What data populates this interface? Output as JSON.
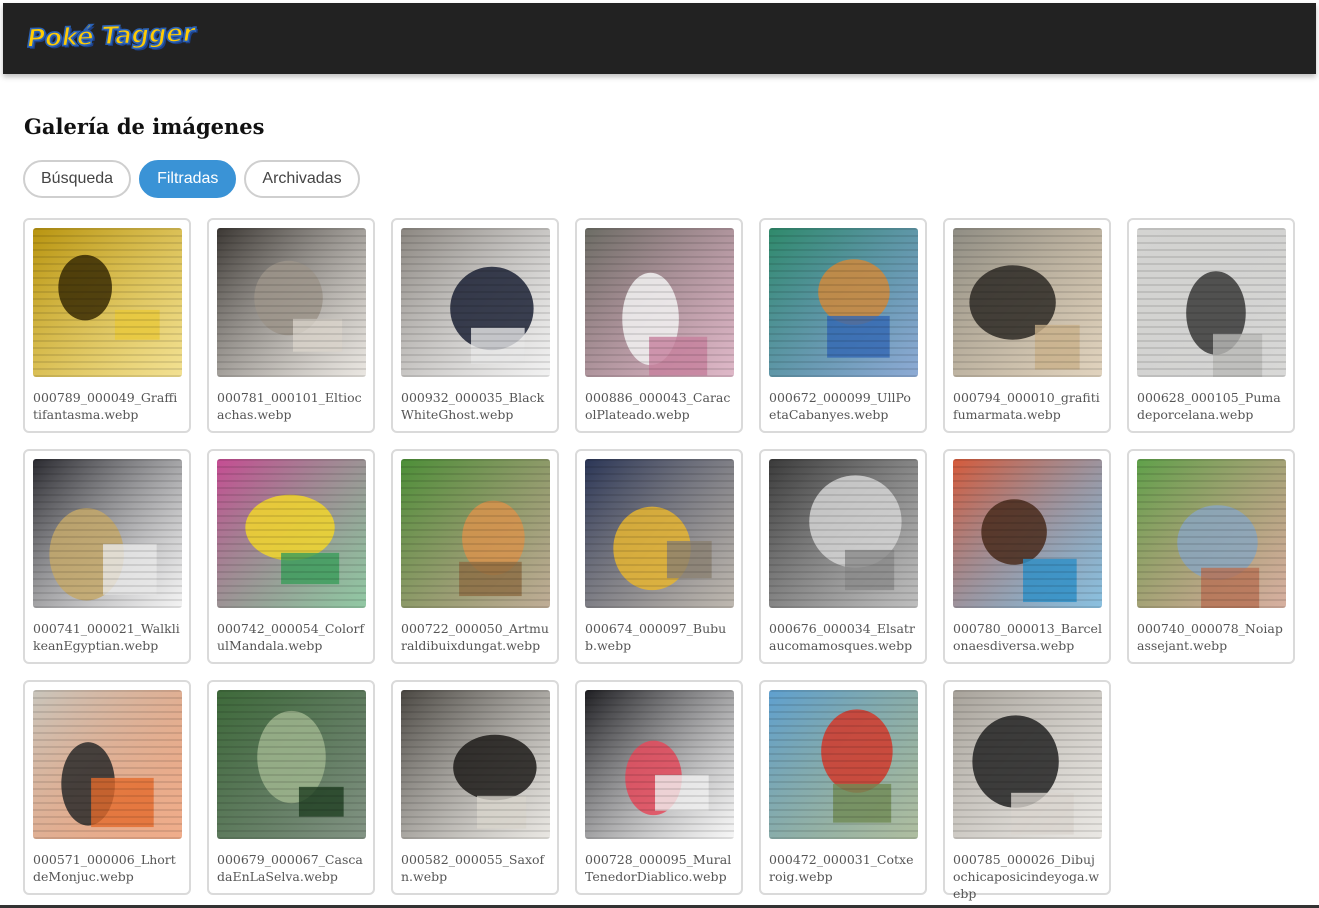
{
  "app": {
    "logo_text": "Poké Tagger"
  },
  "page": {
    "title": "Galería de imágenes"
  },
  "tabs": [
    {
      "label": "Búsqueda",
      "active": false
    },
    {
      "label": "Filtradas",
      "active": true
    },
    {
      "label": "Archivadas",
      "active": false
    }
  ],
  "gallery": [
    {
      "filename": "000789_000049_Graffitifantasma.webp",
      "thumb": {
        "bg": "#b89410",
        "fg": "#3a2c04",
        "accent": "#e8c83a"
      }
    },
    {
      "filename": "000781_000101_Eltiocachas.webp",
      "thumb": {
        "bg": "#3b3733",
        "fg": "#9c948a",
        "accent": "#d9d3ca"
      }
    },
    {
      "filename": "000932_000035_BlackWhiteGhost.webp",
      "thumb": {
        "bg": "#8b8680",
        "fg": "#1c2236",
        "accent": "#e7e7e7"
      }
    },
    {
      "filename": "000886_000043_CaracolPlateado.webp",
      "thumb": {
        "bg": "#6b6c64",
        "fg": "#f3f3f3",
        "accent": "#c57f9c"
      }
    },
    {
      "filename": "000672_000099_UllPoetaCabanyes.webp",
      "thumb": {
        "bg": "#2f8a6a",
        "fg": "#d08a3c",
        "accent": "#3267b3"
      }
    },
    {
      "filename": "000794_000010_grafitifumarmata.webp",
      "thumb": {
        "bg": "#8f8d84",
        "fg": "#2e2a26",
        "accent": "#c9b08a"
      }
    },
    {
      "filename": "000628_000105_Pumadeporcelana.webp",
      "thumb": {
        "bg": "#d4d4d2",
        "fg": "#3a3a3a",
        "accent": "#b9b9b7"
      }
    },
    {
      "filename": "000741_000021_WalklikeanEgyptian.webp",
      "thumb": {
        "bg": "#2a2a30",
        "fg": "#c4a86a",
        "accent": "#e9e9e9"
      }
    },
    {
      "filename": "000742_000054_ColorfulMandala.webp",
      "thumb": {
        "bg": "#c64c93",
        "fg": "#f2d62b",
        "accent": "#3a9c5a"
      }
    },
    {
      "filename": "000722_000050_Artmuraldibuixdungat.webp",
      "thumb": {
        "bg": "#4c8f38",
        "fg": "#d8934c",
        "accent": "#8c6b42"
      }
    },
    {
      "filename": "000674_000097_Bubub.webp",
      "thumb": {
        "bg": "#2a3556",
        "fg": "#e6b531",
        "accent": "#8a7f70"
      }
    },
    {
      "filename": "000676_000034_Elsatraucomamosques.webp",
      "thumb": {
        "bg": "#3a3a3a",
        "fg": "#d5d5d5",
        "accent": "#8a8a8a"
      }
    },
    {
      "filename": "000780_000013_Barcelonaesdiversa.webp",
      "thumb": {
        "bg": "#d65a3a",
        "fg": "#4a2b1c",
        "accent": "#2c8ec7"
      }
    },
    {
      "filename": "000740_000078_Noiapassejant.webp",
      "thumb": {
        "bg": "#5fa14a",
        "fg": "#8aa6c0",
        "accent": "#b77054"
      }
    },
    {
      "filename": "000571_000006_LhortdeMonjuc.webp",
      "thumb": {
        "bg": "#c9c6bd",
        "fg": "#2b2b2b",
        "accent": "#e46b2d"
      }
    },
    {
      "filename": "000679_000067_CascadaEnLaSelva.webp",
      "thumb": {
        "bg": "#3e6a3a",
        "fg": "#9fb58e",
        "accent": "#1f3e22"
      }
    },
    {
      "filename": "000582_000055_Saxofn.webp",
      "thumb": {
        "bg": "#4a4742",
        "fg": "#1e1c1a",
        "accent": "#d8d4cc"
      }
    },
    {
      "filename": "000728_000095_MuralTenedorDiablico.webp",
      "thumb": {
        "bg": "#1e1e22",
        "fg": "#e44a5c",
        "accent": "#f0f0f0"
      }
    },
    {
      "filename": "000472_000031_Cotxeroig.webp",
      "thumb": {
        "bg": "#5fa0d0",
        "fg": "#d23a2c",
        "accent": "#6f8a54"
      }
    },
    {
      "filename": "000785_000026_Dibujochicaposicindeyoga.webp",
      "thumb": {
        "bg": "#a7a29a",
        "fg": "#232323",
        "accent": "#d9d5ce"
      }
    }
  ]
}
